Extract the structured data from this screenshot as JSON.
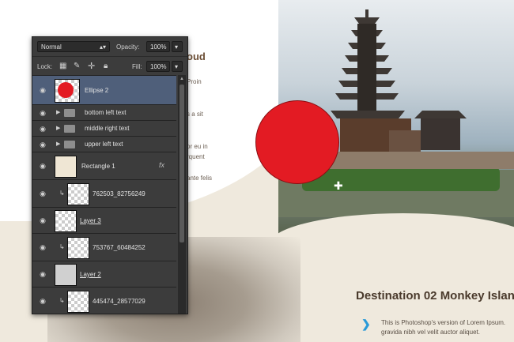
{
  "panel": {
    "blend_mode": "Normal",
    "opacity_label": "Opacity:",
    "opacity_value": "100%",
    "lock_label": "Lock:",
    "fill_label": "Fill:",
    "fill_value": "100%",
    "layers": [
      {
        "name": "Ellipse 2",
        "kind": "shape",
        "selected": true
      },
      {
        "name": "bottom left text",
        "kind": "group"
      },
      {
        "name": "middle right text",
        "kind": "group"
      },
      {
        "name": "upper left text",
        "kind": "group"
      },
      {
        "name": "Rectangle 1",
        "kind": "shape",
        "fx": "fx"
      },
      {
        "name": "762503_82756249",
        "kind": "clipped"
      },
      {
        "name": "Layer 3",
        "kind": "layer"
      },
      {
        "name": "753767_60484252",
        "kind": "clipped"
      },
      {
        "name": "Layer 2",
        "kind": "layer"
      },
      {
        "name": "445474_28577029",
        "kind": "clipped"
      }
    ]
  },
  "page": {
    "heading_partial": "oud",
    "text_fragments": [
      "Proin",
      "s a sit",
      "or eu in",
      "rquent",
      "ante  felis"
    ],
    "dest_title": "Destination 02 Monkey Islan",
    "dest_desc": "This is Photoshop's version  of Lorem Ipsum. gravida nibh vel velit auctor aliquet."
  },
  "colors": {
    "accent_circle": "#e31b23",
    "chevron": "#2a9ad8",
    "selection": "#4f5f7a"
  },
  "icons": {
    "visibility": "eye-icon",
    "group": "folder-icon",
    "clip": "clip-arrow-icon",
    "cursor": "move-crosshair-icon"
  }
}
